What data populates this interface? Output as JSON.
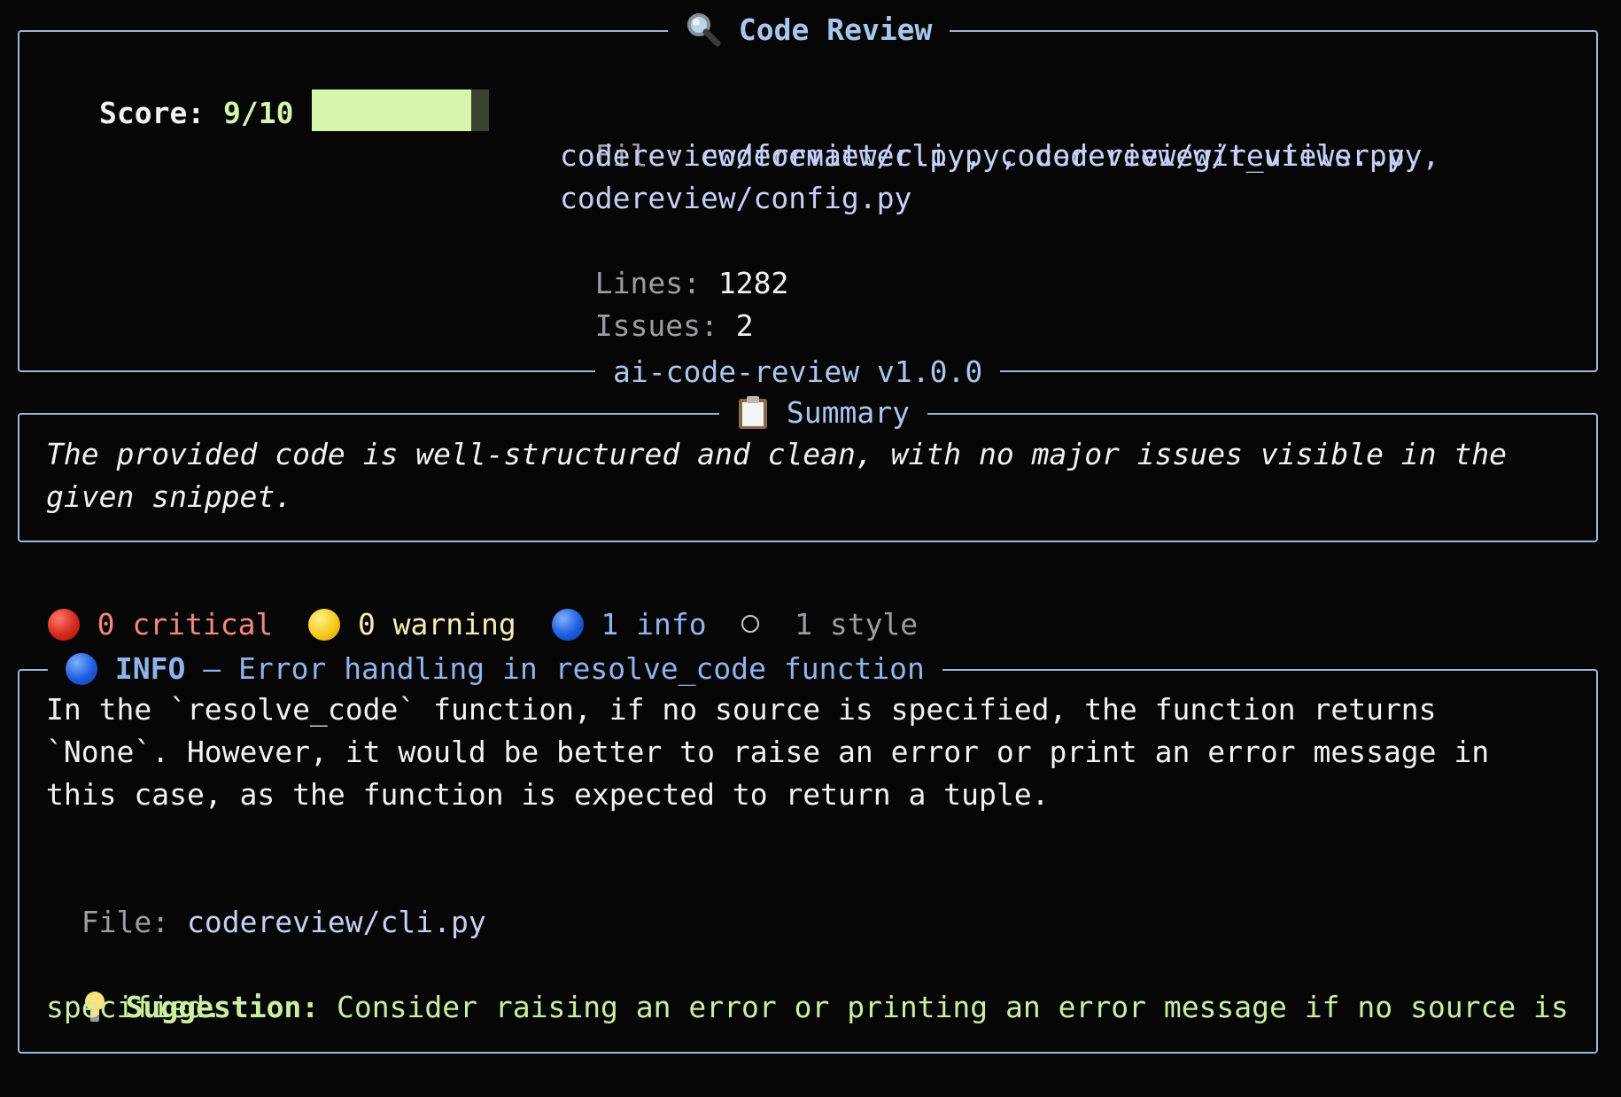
{
  "review_panel": {
    "title": "Code Review",
    "subtitle": "ai-code-review v1.0.0",
    "score_label": "Score:",
    "score_value": "9/10",
    "score_fraction": 0.9,
    "file_label": "File:",
    "file_lines": [
      "codereview/cli.py, codereview/reviewer.py,",
      "codereview/formatter.py, codereview/git_utils.py,",
      "codereview/config.py"
    ],
    "lines_label": "Lines:",
    "lines_value": "1282",
    "issues_label": "Issues:",
    "issues_value": "2"
  },
  "summary_panel": {
    "title": "Summary",
    "lines": [
      "The provided code is well-structured and clean, with no major issues visible in the",
      "given snippet."
    ]
  },
  "counts": {
    "critical": "0 critical",
    "warning": "0 warning",
    "info": "1 info",
    "style": "1 style"
  },
  "issue_panel": {
    "severity": "INFO",
    "separator": "—",
    "title": "Error handling in resolve_code function",
    "body_lines": [
      "In the `resolve_code` function, if no source is specified, the function returns",
      "`None`. However, it would be better to raise an error or print an error message in",
      "this case, as the function is expected to return a tuple."
    ],
    "file_label": "File:",
    "file_value": "codereview/cli.py",
    "suggestion_label": "Suggestion:",
    "suggestion_line1": "Consider raising an error or printing an error message if no source is",
    "suggestion_line2": "specified."
  },
  "colors": {
    "border": "#9ab8dd",
    "score": "#d8f5ad",
    "critical": "#f08a78",
    "warning": "#f5eeb0",
    "info": "#8fb4ec",
    "suggestion": "#cbeea0"
  },
  "icons": [
    "magnifier-icon",
    "clipboard-icon",
    "red-circle-icon",
    "yellow-circle-icon",
    "blue-circle-icon",
    "white-circle-icon",
    "lightbulb-icon"
  ]
}
